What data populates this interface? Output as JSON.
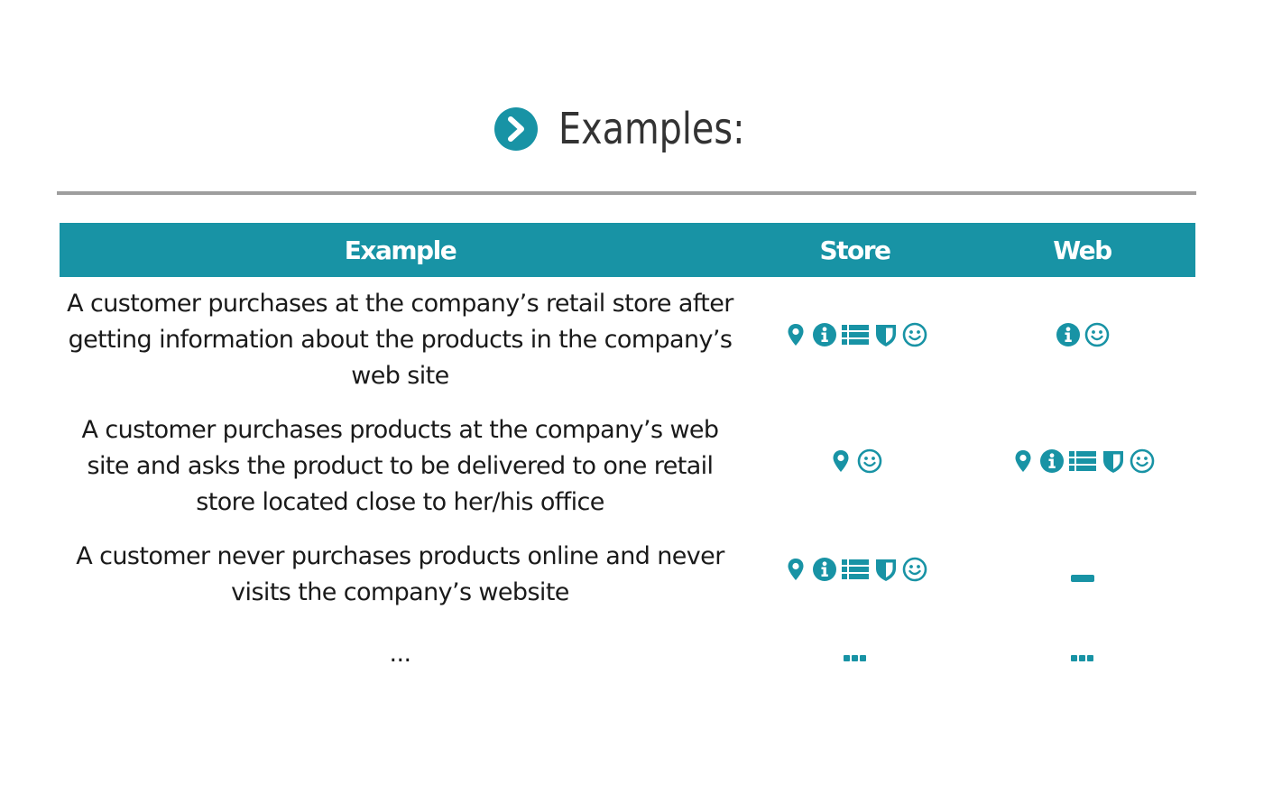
{
  "heading": {
    "title": "Examples:",
    "icon": "chevron-right-circle-icon"
  },
  "colors": {
    "accent": "#1893a5",
    "rule": "#9e9e9e",
    "title": "#333333"
  },
  "table": {
    "headers": [
      "Example",
      "Store",
      "Web"
    ],
    "rows": [
      {
        "example": "A customer purchases at the company’s retail store after getting information about the products in the company’s web site",
        "store": [
          "location-pin-icon",
          "info-icon",
          "list-icon",
          "shield-icon",
          "smiley-icon"
        ],
        "web": [
          "info-icon",
          "smiley-icon"
        ]
      },
      {
        "example": "A customer purchases products at the company’s web site and asks the product to be delivered to one retail store located close to her/his office",
        "store": [
          "location-pin-icon",
          "smiley-icon"
        ],
        "web": [
          "location-pin-icon",
          "info-icon",
          "list-icon",
          "shield-icon",
          "smiley-icon"
        ]
      },
      {
        "example": "A customer never purchases products online and never visits the company’s website",
        "store": [
          "location-pin-icon",
          "info-icon",
          "list-icon",
          "shield-icon",
          "smiley-icon"
        ],
        "web": [
          "dash-icon"
        ]
      },
      {
        "example": "...",
        "store": [
          "ellipsis-icon"
        ],
        "web": [
          "ellipsis-icon"
        ]
      }
    ]
  }
}
